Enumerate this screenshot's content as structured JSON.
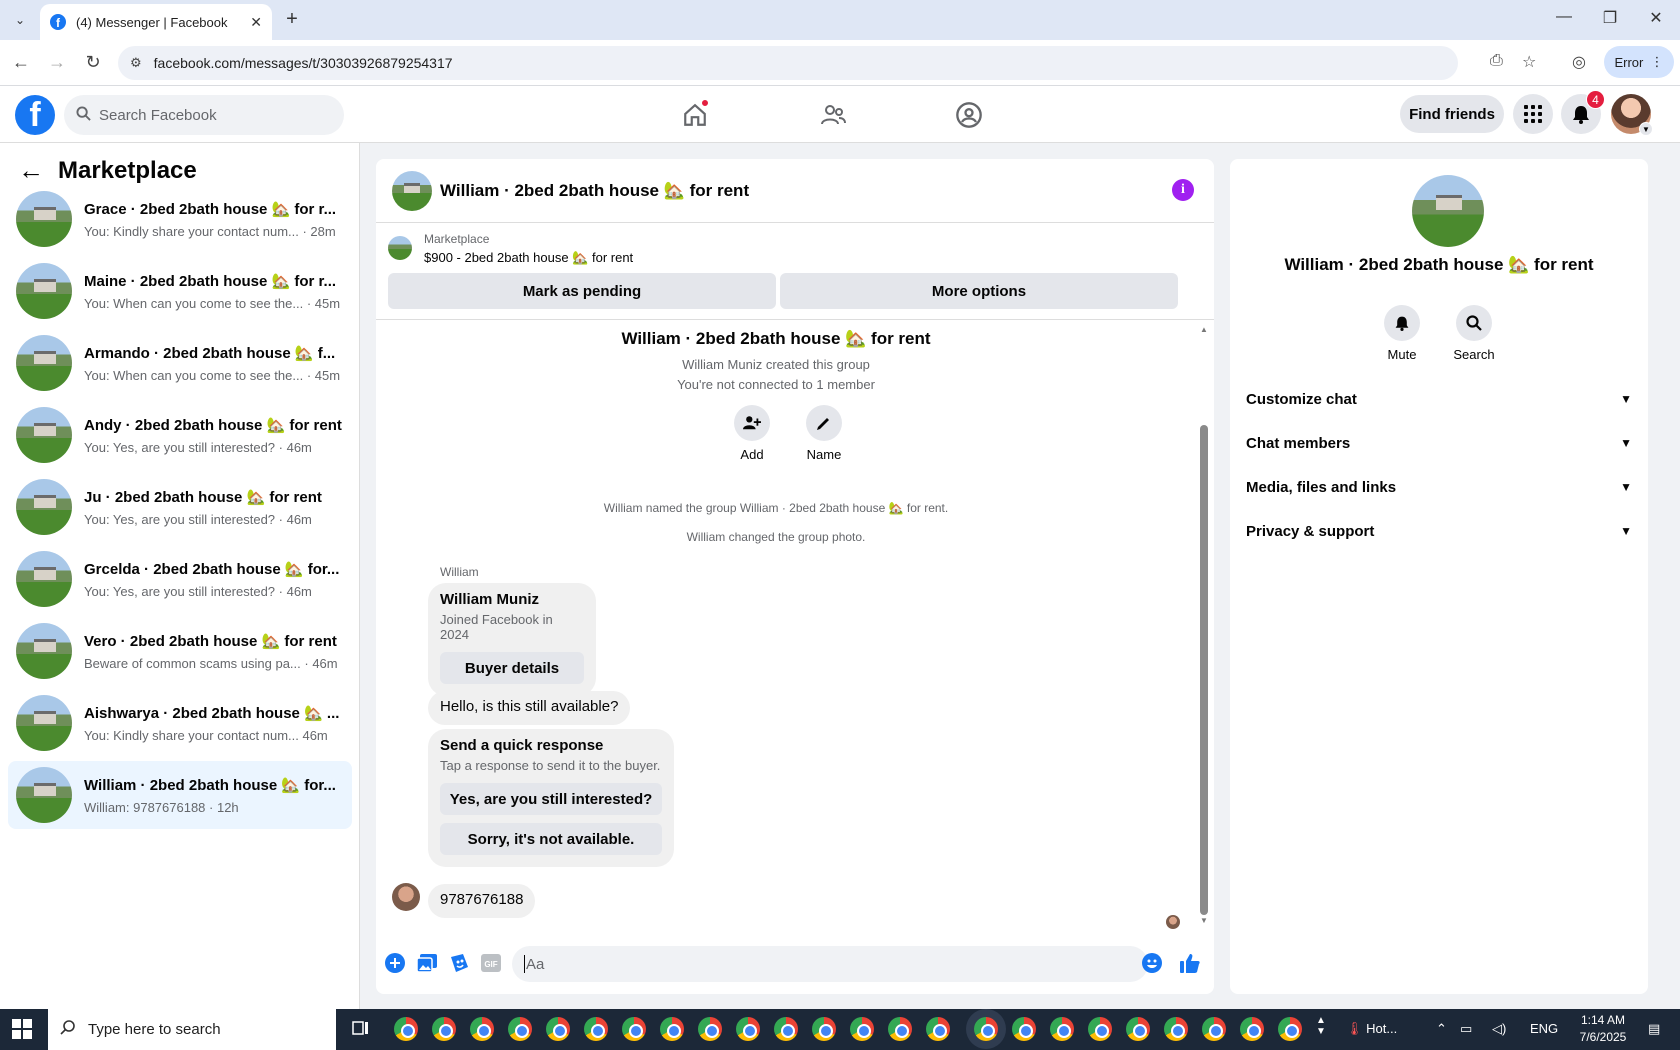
{
  "browser": {
    "tab_title": "(4) Messenger | Facebook",
    "url": "facebook.com/messages/t/30303926879254317",
    "profile_button": "Error"
  },
  "fb": {
    "search_placeholder": "Search Facebook",
    "find_friends": "Find friends",
    "notifications_count": "4"
  },
  "sidebar": {
    "title": "Marketplace",
    "conversations": [
      {
        "name": "Grace · 2bed 2bath house 🏡 for r...",
        "snippet": "You: Kindly share your contact num... · 28m"
      },
      {
        "name": "Maine · 2bed 2bath house 🏡 for r...",
        "snippet": "You: When can you come to see the... · 45m"
      },
      {
        "name": "Armando · 2bed 2bath house 🏡 f...",
        "snippet": "You: When can you come to see the... · 45m"
      },
      {
        "name": "Andy · 2bed 2bath house 🏡 for rent",
        "snippet": "You: Yes, are you still interested? · 46m"
      },
      {
        "name": "Ju · 2bed 2bath house 🏡 for rent",
        "snippet": "You: Yes, are you still interested? · 46m"
      },
      {
        "name": "Grcelda · 2bed 2bath house 🏡 for...",
        "snippet": "You: Yes, are you still interested? · 46m"
      },
      {
        "name": "Vero · 2bed 2bath house 🏡 for rent",
        "snippet": "Beware of common scams using pa... · 46m"
      },
      {
        "name": "Aishwarya · 2bed 2bath house 🏡 ...",
        "snippet": "You: Kindly share your contact num... 46m"
      },
      {
        "name": "William · 2bed 2bath house 🏡 for...",
        "snippet": "William: 9787676188 · 12h"
      }
    ]
  },
  "chat": {
    "title": "William · 2bed 2bath house 🏡 for rent",
    "marketplace_label": "Marketplace",
    "listing": "$900 - 2bed 2bath house 🏡 for rent",
    "mark_pending": "Mark as pending",
    "more_options": "More options",
    "group_title": "William · 2bed 2bath house 🏡 for rent",
    "created": "William Muniz created this group",
    "not_connected": "You're not connected to 1 member",
    "add_label": "Add",
    "name_label": "Name",
    "sys_named": "William named the group William · 2bed 2bath house 🏡 for rent.",
    "sys_photo": "William changed the group photo.",
    "sender": "William",
    "card_title": "William Muniz",
    "card_sub": "Joined Facebook in 2024",
    "buyer_details": "Buyer details",
    "msg1": "Hello, is this still available?",
    "quick_title": "Send a quick response",
    "quick_sub": "Tap a response to send it to the buyer.",
    "quick_1": "Yes, are you still interested?",
    "quick_2": "Sorry, it's not available.",
    "msg2": "9787676188",
    "composer_placeholder": "Aa"
  },
  "info": {
    "title": "William · 2bed 2bath house 🏡 for rent",
    "mute": "Mute",
    "search": "Search",
    "sections": [
      "Customize chat",
      "Chat members",
      "Media, files and links",
      "Privacy & support"
    ]
  },
  "taskbar": {
    "search_placeholder": "Type here to search",
    "weather": "Hot...",
    "lang": "ENG",
    "time": "1:14 AM",
    "date": "7/6/2025"
  },
  "colors": {
    "fb_blue": "#1877f2",
    "active_conv": "#ebf5ff",
    "info_purple": "#a020f0",
    "badge_red": "#e41e3f"
  }
}
